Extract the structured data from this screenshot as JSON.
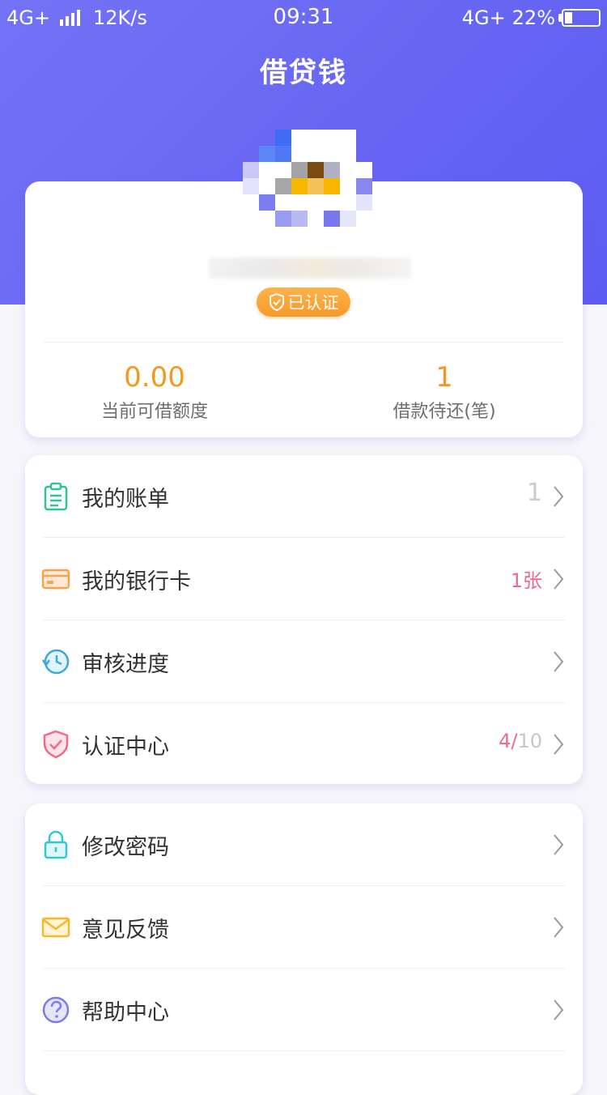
{
  "status_bar": {
    "network_left": "4G+",
    "speed": "12K/s",
    "time": "09:31",
    "network_right": "4G+",
    "battery": "22%",
    "battery_level": 0.22
  },
  "header": {
    "title": "借贷钱"
  },
  "profile": {
    "verified_label": "已认证",
    "stats": [
      {
        "value": "0.00",
        "label": "当前可借额度"
      },
      {
        "value": "1",
        "label": "借款待还(笔)"
      }
    ]
  },
  "menu_group_1": [
    {
      "label": "我的账单",
      "extra": "1",
      "icon": "clipboard-icon"
    },
    {
      "label": "我的银行卡",
      "extra": "1张",
      "icon": "bank-card-icon"
    },
    {
      "label": "审核进度",
      "extra": "",
      "icon": "clock-icon"
    },
    {
      "label": "认证中心",
      "extra_done": "4",
      "extra_sep": "/",
      "extra_total": "10",
      "icon": "shield-check-icon"
    }
  ],
  "menu_group_2": [
    {
      "label": "修改密码",
      "icon": "lock-icon"
    },
    {
      "label": "意见反馈",
      "icon": "envelope-icon"
    },
    {
      "label": "帮助中心",
      "icon": "question-icon"
    }
  ],
  "colors": {
    "header_gradient_start": "#7473f6",
    "header_gradient_end": "#5b5cf2",
    "accent_orange": "#f39a1e",
    "badge_orange": "#f79a2b",
    "pink": "#f06a8e"
  }
}
